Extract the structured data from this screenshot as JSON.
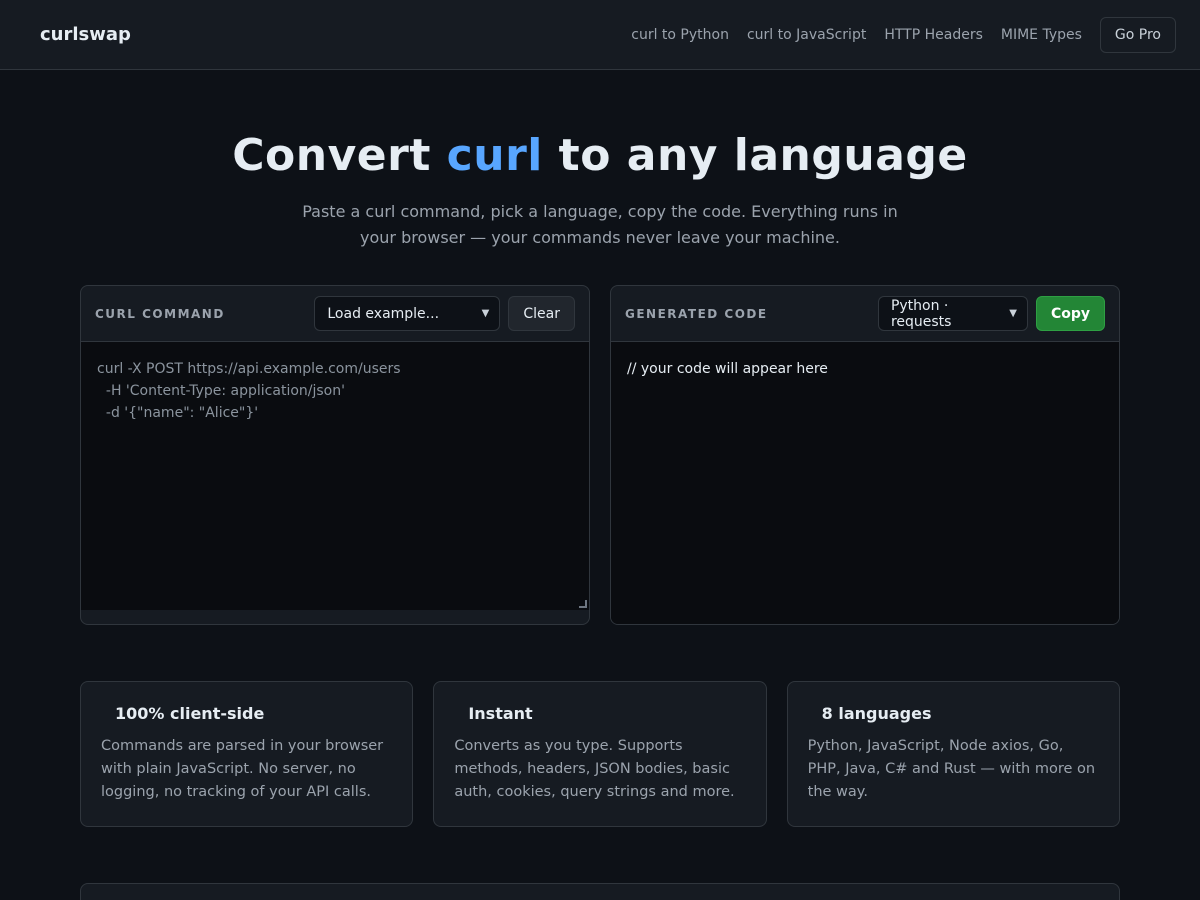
{
  "header": {
    "logo": "curlswap",
    "nav": [
      "curl to Python",
      "curl to JavaScript",
      "HTTP Headers",
      "MIME Types"
    ],
    "pro_label": "Go Pro"
  },
  "hero": {
    "title_before": "Convert ",
    "title_accent": "curl",
    "title_after": " to any language",
    "subtitle": "Paste a curl command, pick a language, copy the code. Everything runs in your browser — your commands never leave your machine."
  },
  "input_panel": {
    "title": "CURL COMMAND",
    "example_select": "Load example...",
    "clear_label": "Clear",
    "placeholder_lines": [
      "curl -X POST https://api.example.com/users",
      "  -H 'Content-Type: application/json'",
      "  -d '{\"name\": \"Alice\"}'"
    ]
  },
  "output_panel": {
    "title": "GENERATED CODE",
    "language_select": "Python · requests",
    "copy_label": "Copy",
    "code": "// your code will appear here"
  },
  "features": [
    {
      "title": "100% client-side",
      "text": "Commands are parsed in your browser with plain JavaScript. No server, no logging, no tracking of your API calls."
    },
    {
      "title": "Instant",
      "text": "Converts as you type. Supports methods, headers, JSON bodies, basic auth, cookies, query strings and more."
    },
    {
      "title": "8 languages",
      "text": "Python, JavaScript, Node axios, Go, PHP, Java, C# and Rust — with more on the way."
    }
  ],
  "colors": {
    "background": "#0d1117",
    "accent": "#58a6ff",
    "copy_button": "#238636"
  }
}
